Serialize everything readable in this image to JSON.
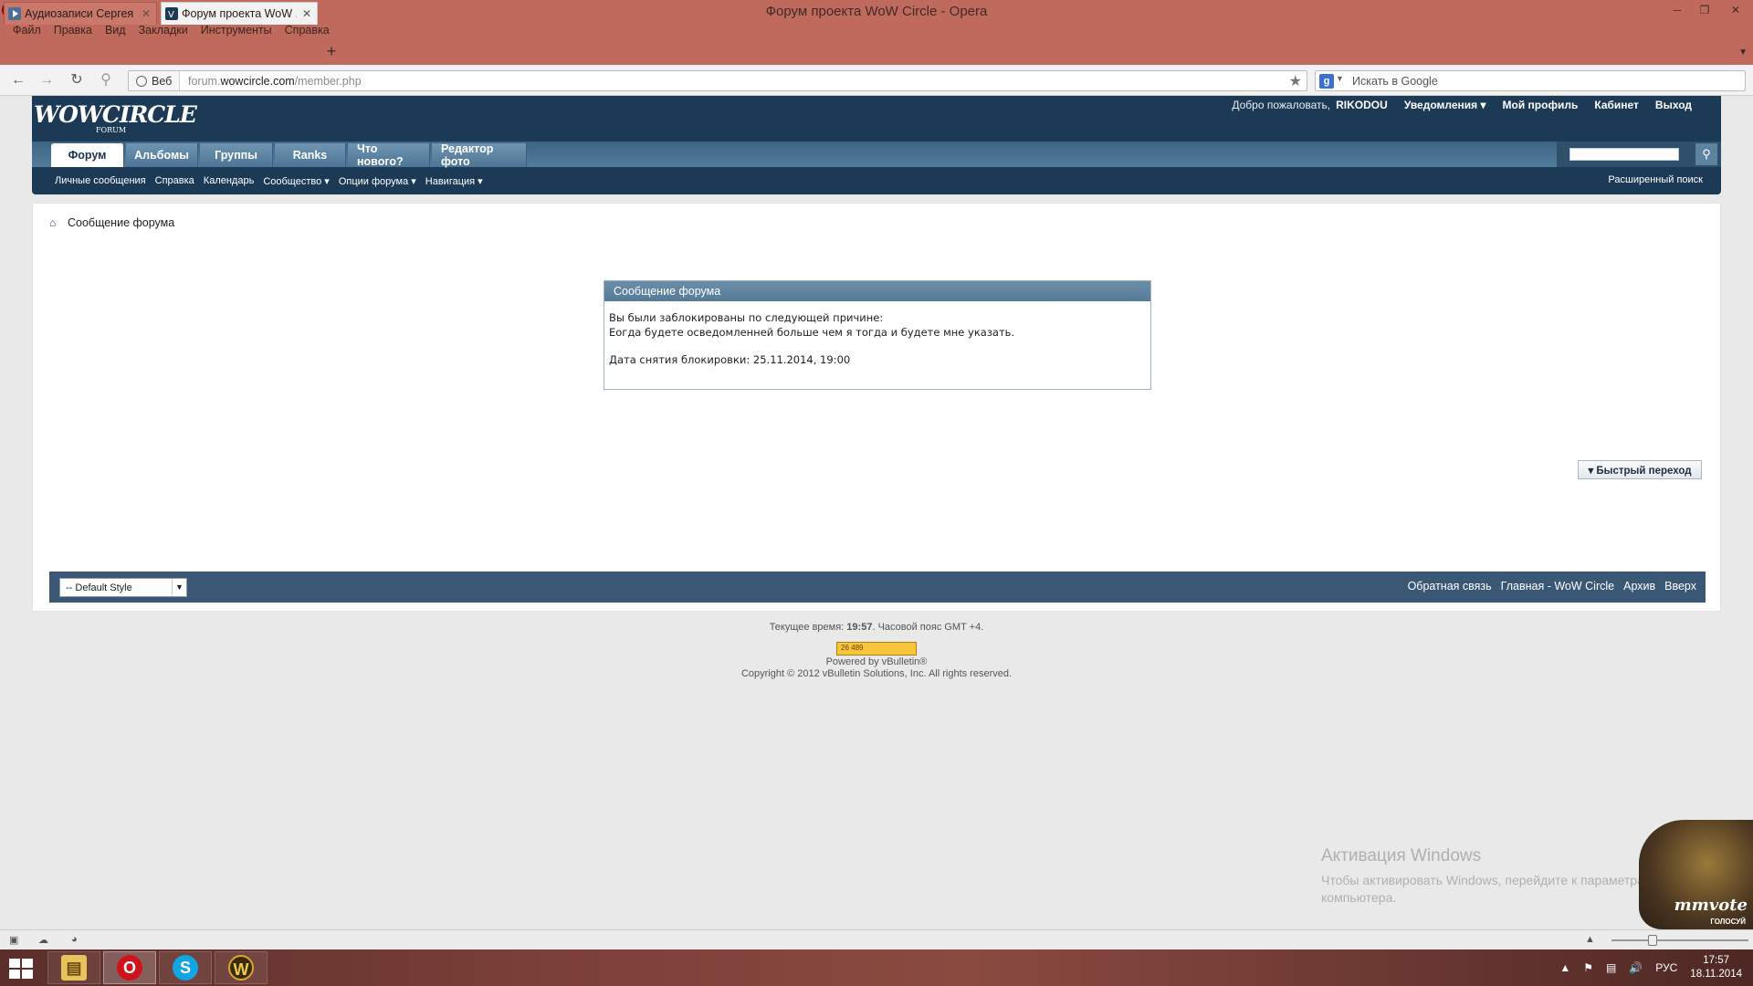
{
  "window": {
    "title": "Форум проекта WoW Circle - Opera"
  },
  "menu": [
    "Файл",
    "Правка",
    "Вид",
    "Закладки",
    "Инструменты",
    "Справка"
  ],
  "tabs": [
    {
      "label": "Аудиозаписи Сергея ...",
      "active": false
    },
    {
      "label": "Форум проекта WoW ...",
      "active": true
    }
  ],
  "address": {
    "badge": "Веб",
    "url_prefix": "forum.",
    "url_domain": "wowcircle.com",
    "url_path": "/member.php"
  },
  "search": {
    "placeholder": "Искать в Google"
  },
  "forum": {
    "logo": "WOWCIRCLE",
    "logo_sub": "FORUM",
    "welcome": "Добро пожаловать,",
    "username": "RIKODOU",
    "toplinks": [
      "Уведомления ▾",
      "Мой профиль",
      "Кабинет",
      "Выход"
    ],
    "navtabs": [
      "Форум",
      "Альбомы",
      "Группы",
      "Ranks",
      "Что нового?",
      "Редактор фото"
    ],
    "subnav": [
      "Личные сообщения",
      "Справка",
      "Календарь",
      "Сообщество ▾",
      "Опции форума ▾",
      "Навигация ▾"
    ],
    "advanced_search": "Расширенный поиск"
  },
  "breadcrumb": "Сообщение форума",
  "message": {
    "header": "Сообщение форума",
    "line1": "Вы были заблокированы по следующей причине:",
    "line2": "Eогда будете осведомленней больше чем я тогда и будете мне указать.",
    "unban": "Дата снятия блокировки: 25.11.2014, 19:00"
  },
  "quick_nav": "▾ Быстрый переход",
  "footer": {
    "style": "-- Default Style",
    "links": [
      "Обратная связь",
      "Главная - WoW Circle",
      "Архив",
      "Вверх"
    ]
  },
  "below_footer": {
    "time_label": "Текущее время:",
    "time": "19:57",
    "timezone": "Часовой пояс GMT +4.",
    "counter": "26 489",
    "powered": "Powered by vBulletin®",
    "copyright": "Copyright © 2012 vBulletin Solutions, Inc. All rights reserved."
  },
  "activation": {
    "title": "Активация Windows",
    "text": "Чтобы активировать Windows, перейдите к параметрам компьютера."
  },
  "mmvote": {
    "logo": "mmvote",
    "sub": "ГОЛОСУЙ"
  },
  "taskbar": {
    "lang": "РУС",
    "time": "17:57",
    "date": "18.11.2014"
  },
  "colors": {
    "chrome": "#bf6a5c",
    "forum_header": "#1c3a56",
    "footer_bar": "#3a5775"
  }
}
